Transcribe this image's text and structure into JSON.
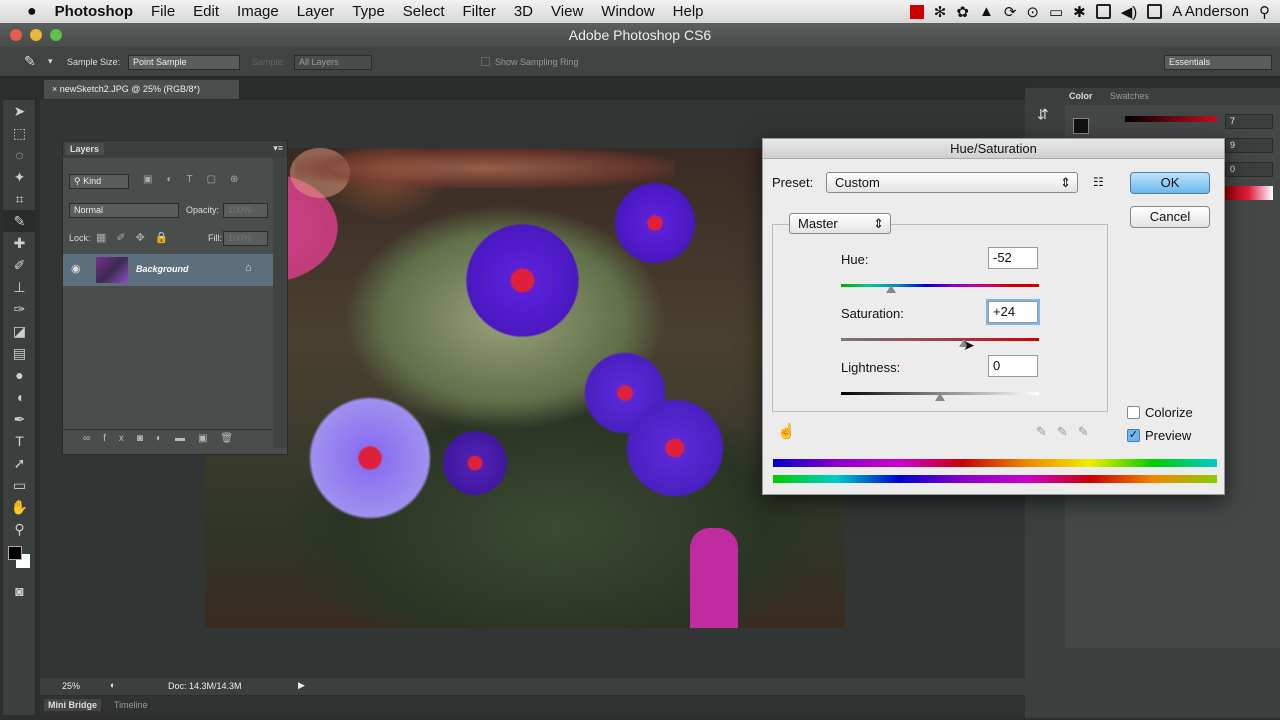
{
  "menubar": {
    "apple": "",
    "app": "Photoshop",
    "items": [
      "File",
      "Edit",
      "Image",
      "Layer",
      "Type",
      "Select",
      "Filter",
      "3D",
      "View",
      "Window",
      "Help"
    ],
    "user": "A Anderson"
  },
  "window": {
    "title": "Adobe Photoshop CS6"
  },
  "options": {
    "sample_size_label": "Sample Size:",
    "sample_size_value": "Point Sample",
    "sample_label": "Sample:",
    "sample_value": "All Layers",
    "show_ring": "Show Sampling Ring",
    "workspace": "Essentials"
  },
  "document": {
    "tab": "newSketch2.JPG @ 25% (RGB/8*)"
  },
  "layers": {
    "title": "Layers",
    "filter": "Kind",
    "blend": "Normal",
    "opacity_label": "Opacity:",
    "opacity": "100%",
    "lock_label": "Lock:",
    "fill_label": "Fill:",
    "fill": "100%",
    "layer_name": "Background"
  },
  "color_panel": {
    "tabs": [
      "Color",
      "Swatches"
    ],
    "values": [
      "7",
      "9",
      "0"
    ]
  },
  "status": {
    "zoom": "25%",
    "doc": "Doc: 14.3M/14.3M",
    "tabs": [
      "Mini Bridge",
      "Timeline"
    ]
  },
  "dialog": {
    "title": "Hue/Saturation",
    "preset_label": "Preset:",
    "preset": "Custom",
    "ok": "OK",
    "cancel": "Cancel",
    "channel": "Master",
    "hue_label": "Hue:",
    "hue": "-52",
    "sat_label": "Saturation:",
    "sat": "+24",
    "light_label": "Lightness:",
    "light": "0",
    "colorize": "Colorize",
    "preview": "Preview",
    "hue_pos": 0.25,
    "sat_pos": 0.62,
    "light_pos": 0.5
  }
}
